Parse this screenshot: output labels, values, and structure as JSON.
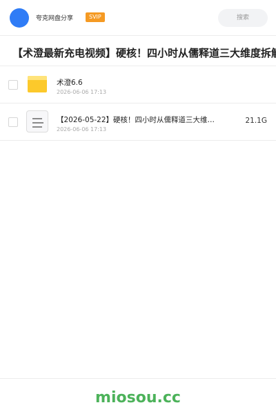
{
  "header": {
    "app_name": "夸克网盘分享",
    "badge": "SVIP",
    "search_label": "搜索",
    "accent": "#2f7cf6",
    "badge_color": "#f59a23"
  },
  "title": "【术澄最新充电视频】硬核！四小时从儒释道三大维度拆解",
  "files": [
    {
      "icon": "folder-icon",
      "name": "术澄6.6",
      "date": "2026-06-06 17:13",
      "size": ""
    },
    {
      "icon": "document-icon",
      "name": "【2026-05-22】硬核！四小时从儒释道三大维…",
      "date": "2026-06-06 17:13",
      "size": "21.1G"
    }
  ],
  "footer": {
    "brand": "miosou.cc",
    "brand_color": "#4cb25a"
  }
}
